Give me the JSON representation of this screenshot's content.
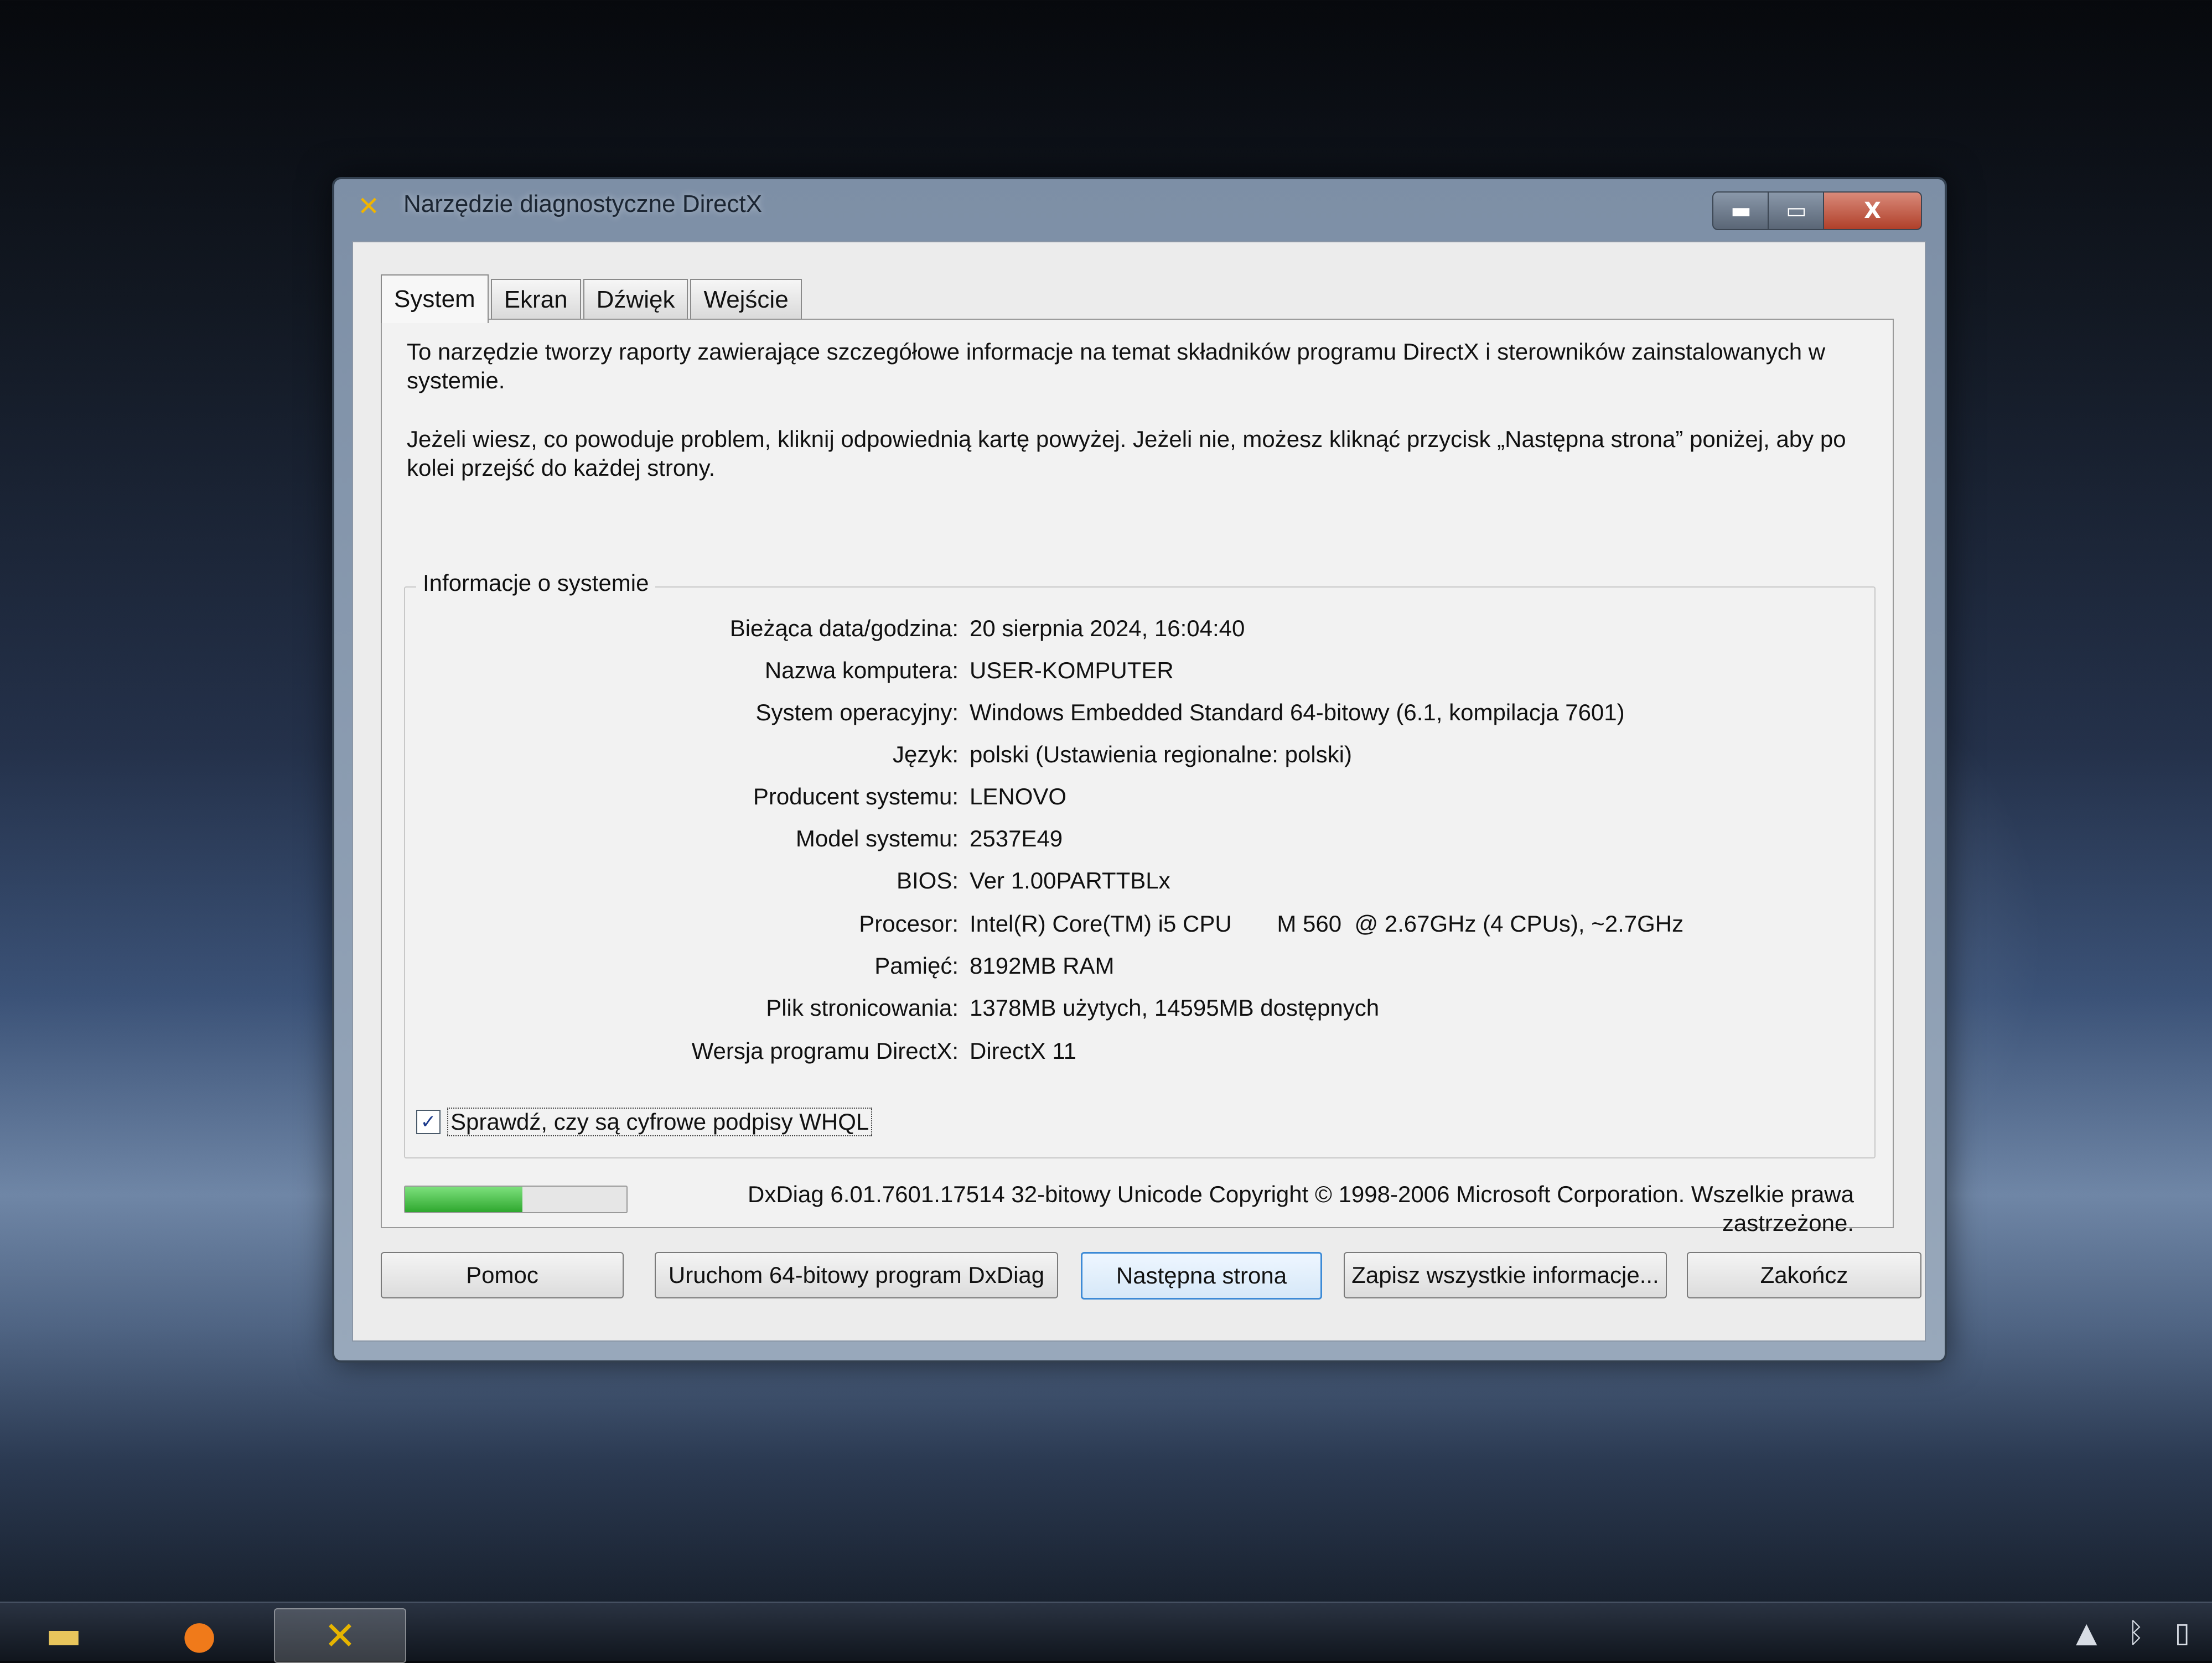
{
  "window": {
    "title": "Narzędzie diagnostyczne DirectX",
    "app_icon": "dxdiag-icon",
    "controls": {
      "minimize": "▬",
      "maximize": "▭",
      "close": "X"
    }
  },
  "tabs": [
    {
      "label": "System",
      "active": true
    },
    {
      "label": "Ekran",
      "active": false
    },
    {
      "label": "Dźwięk",
      "active": false
    },
    {
      "label": "Wejście",
      "active": false
    }
  ],
  "intro": {
    "line1": "To narzędzie tworzy raporty zawierające szczegółowe informacje na temat składników programu DirectX i sterowników zainstalowanych w systemie.",
    "line2": "Jeżeli wiesz, co powoduje problem, kliknij odpowiednią kartę powyżej. Jeżeli nie, możesz kliknąć przycisk „Następna strona” poniżej, aby po kolei przejść do każdej strony."
  },
  "system_info": {
    "group_label": "Informacje o systemie",
    "rows": [
      {
        "label": "Bieżąca data/godzina:",
        "value": "20 sierpnia 2024, 16:04:40"
      },
      {
        "label": "Nazwa komputera:",
        "value": "USER-KOMPUTER"
      },
      {
        "label": "System operacyjny:",
        "value": "Windows Embedded Standard 64-bitowy (6.1, kompilacja 7601)"
      },
      {
        "label": "Język:",
        "value": "polski (Ustawienia regionalne: polski)"
      },
      {
        "label": "Producent systemu:",
        "value": "LENOVO"
      },
      {
        "label": "Model systemu:",
        "value": "2537E49"
      },
      {
        "label": "BIOS:",
        "value": "Ver 1.00PARTTBLx"
      },
      {
        "label": "Procesor:",
        "value": "Intel(R) Core(TM) i5 CPU       M 560  @ 2.67GHz (4 CPUs), ~2.7GHz"
      },
      {
        "label": "Pamięć:",
        "value": "8192MB RAM"
      },
      {
        "label": "Plik stronicowania:",
        "value": "1378MB użytych, 14595MB dostępnych"
      },
      {
        "label": "Wersja programu DirectX:",
        "value": "DirectX 11"
      }
    ],
    "whql_checkbox": {
      "label": "Sprawdź, czy są cyfrowe podpisy WHQL",
      "checked": true,
      "mark": "✓"
    }
  },
  "status": {
    "progress": 0.53,
    "copyright": "DxDiag 6.01.7601.17514 32-bitowy Unicode  Copyright © 1998-2006 Microsoft Corporation. Wszelkie prawa zastrzeżone."
  },
  "buttons": {
    "help": "Pomoc",
    "run64": "Uruchom 64-bitowy program DxDiag",
    "next": "Następna strona",
    "save": "Zapisz wszystkie informacje...",
    "exit": "Zakończ"
  },
  "taskbar": {
    "items": [
      "folder-icon",
      "firefox-icon",
      "dxdiag-icon"
    ],
    "tray": [
      "show-hidden-icons",
      "bluetooth-icon",
      "battery-icon"
    ]
  },
  "colors": {
    "progress_fill": "#2fa82f",
    "focus_border": "#3c8ad6",
    "close_button": "#b0402a"
  }
}
